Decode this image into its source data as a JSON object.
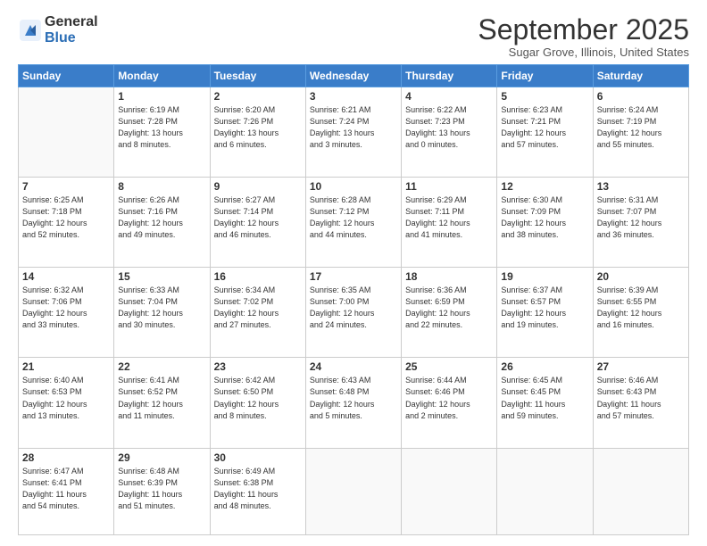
{
  "logo": {
    "general": "General",
    "blue": "Blue"
  },
  "header": {
    "month": "September 2025",
    "location": "Sugar Grove, Illinois, United States"
  },
  "weekdays": [
    "Sunday",
    "Monday",
    "Tuesday",
    "Wednesday",
    "Thursday",
    "Friday",
    "Saturday"
  ],
  "weeks": [
    [
      {
        "day": "",
        "info": ""
      },
      {
        "day": "1",
        "info": "Sunrise: 6:19 AM\nSunset: 7:28 PM\nDaylight: 13 hours\nand 8 minutes."
      },
      {
        "day": "2",
        "info": "Sunrise: 6:20 AM\nSunset: 7:26 PM\nDaylight: 13 hours\nand 6 minutes."
      },
      {
        "day": "3",
        "info": "Sunrise: 6:21 AM\nSunset: 7:24 PM\nDaylight: 13 hours\nand 3 minutes."
      },
      {
        "day": "4",
        "info": "Sunrise: 6:22 AM\nSunset: 7:23 PM\nDaylight: 13 hours\nand 0 minutes."
      },
      {
        "day": "5",
        "info": "Sunrise: 6:23 AM\nSunset: 7:21 PM\nDaylight: 12 hours\nand 57 minutes."
      },
      {
        "day": "6",
        "info": "Sunrise: 6:24 AM\nSunset: 7:19 PM\nDaylight: 12 hours\nand 55 minutes."
      }
    ],
    [
      {
        "day": "7",
        "info": "Sunrise: 6:25 AM\nSunset: 7:18 PM\nDaylight: 12 hours\nand 52 minutes."
      },
      {
        "day": "8",
        "info": "Sunrise: 6:26 AM\nSunset: 7:16 PM\nDaylight: 12 hours\nand 49 minutes."
      },
      {
        "day": "9",
        "info": "Sunrise: 6:27 AM\nSunset: 7:14 PM\nDaylight: 12 hours\nand 46 minutes."
      },
      {
        "day": "10",
        "info": "Sunrise: 6:28 AM\nSunset: 7:12 PM\nDaylight: 12 hours\nand 44 minutes."
      },
      {
        "day": "11",
        "info": "Sunrise: 6:29 AM\nSunset: 7:11 PM\nDaylight: 12 hours\nand 41 minutes."
      },
      {
        "day": "12",
        "info": "Sunrise: 6:30 AM\nSunset: 7:09 PM\nDaylight: 12 hours\nand 38 minutes."
      },
      {
        "day": "13",
        "info": "Sunrise: 6:31 AM\nSunset: 7:07 PM\nDaylight: 12 hours\nand 36 minutes."
      }
    ],
    [
      {
        "day": "14",
        "info": "Sunrise: 6:32 AM\nSunset: 7:06 PM\nDaylight: 12 hours\nand 33 minutes."
      },
      {
        "day": "15",
        "info": "Sunrise: 6:33 AM\nSunset: 7:04 PM\nDaylight: 12 hours\nand 30 minutes."
      },
      {
        "day": "16",
        "info": "Sunrise: 6:34 AM\nSunset: 7:02 PM\nDaylight: 12 hours\nand 27 minutes."
      },
      {
        "day": "17",
        "info": "Sunrise: 6:35 AM\nSunset: 7:00 PM\nDaylight: 12 hours\nand 24 minutes."
      },
      {
        "day": "18",
        "info": "Sunrise: 6:36 AM\nSunset: 6:59 PM\nDaylight: 12 hours\nand 22 minutes."
      },
      {
        "day": "19",
        "info": "Sunrise: 6:37 AM\nSunset: 6:57 PM\nDaylight: 12 hours\nand 19 minutes."
      },
      {
        "day": "20",
        "info": "Sunrise: 6:39 AM\nSunset: 6:55 PM\nDaylight: 12 hours\nand 16 minutes."
      }
    ],
    [
      {
        "day": "21",
        "info": "Sunrise: 6:40 AM\nSunset: 6:53 PM\nDaylight: 12 hours\nand 13 minutes."
      },
      {
        "day": "22",
        "info": "Sunrise: 6:41 AM\nSunset: 6:52 PM\nDaylight: 12 hours\nand 11 minutes."
      },
      {
        "day": "23",
        "info": "Sunrise: 6:42 AM\nSunset: 6:50 PM\nDaylight: 12 hours\nand 8 minutes."
      },
      {
        "day": "24",
        "info": "Sunrise: 6:43 AM\nSunset: 6:48 PM\nDaylight: 12 hours\nand 5 minutes."
      },
      {
        "day": "25",
        "info": "Sunrise: 6:44 AM\nSunset: 6:46 PM\nDaylight: 12 hours\nand 2 minutes."
      },
      {
        "day": "26",
        "info": "Sunrise: 6:45 AM\nSunset: 6:45 PM\nDaylight: 11 hours\nand 59 minutes."
      },
      {
        "day": "27",
        "info": "Sunrise: 6:46 AM\nSunset: 6:43 PM\nDaylight: 11 hours\nand 57 minutes."
      }
    ],
    [
      {
        "day": "28",
        "info": "Sunrise: 6:47 AM\nSunset: 6:41 PM\nDaylight: 11 hours\nand 54 minutes."
      },
      {
        "day": "29",
        "info": "Sunrise: 6:48 AM\nSunset: 6:39 PM\nDaylight: 11 hours\nand 51 minutes."
      },
      {
        "day": "30",
        "info": "Sunrise: 6:49 AM\nSunset: 6:38 PM\nDaylight: 11 hours\nand 48 minutes."
      },
      {
        "day": "",
        "info": ""
      },
      {
        "day": "",
        "info": ""
      },
      {
        "day": "",
        "info": ""
      },
      {
        "day": "",
        "info": ""
      }
    ]
  ]
}
